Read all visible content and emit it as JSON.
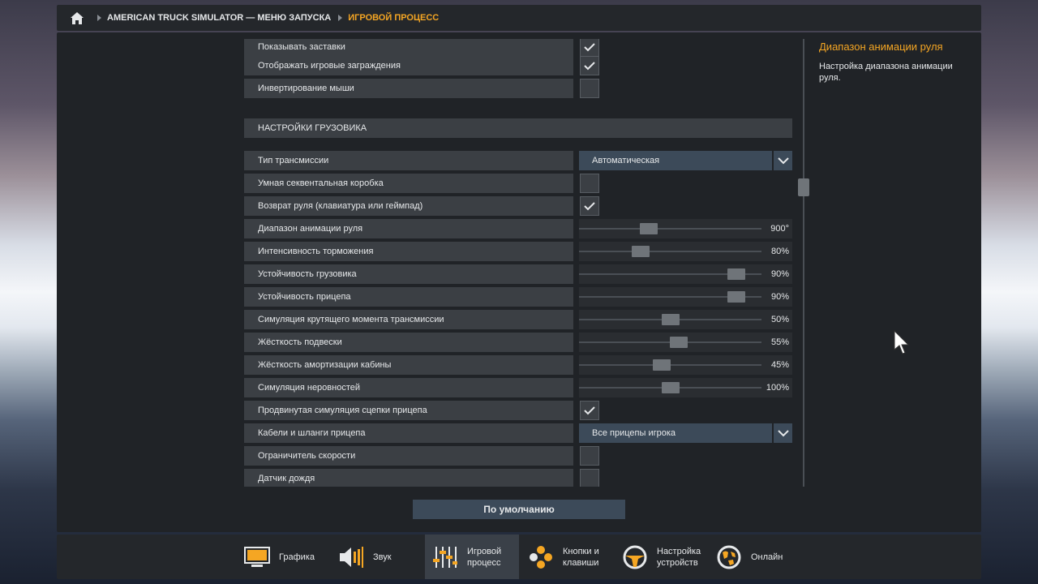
{
  "breadcrumb": {
    "items": [
      "AMERICAN TRUCK SIMULATOR — МЕНЮ ЗАПУСКА",
      "ИГРОВОЙ ПРОЦЕСС"
    ]
  },
  "settings": {
    "top_rows": [
      {
        "label": "Показывать заставки",
        "checked": true
      },
      {
        "label": "Отображать игровые заграждения",
        "checked": true
      },
      {
        "label": "Инвертирование мыши",
        "checked": false
      }
    ],
    "section_title": "НАСТРОЙКИ ГРУЗОВИКА",
    "transmission": {
      "label": "Тип трансмиссии",
      "value": "Автоматическая"
    },
    "smart_gearbox": {
      "label": "Умная секвентальная коробка",
      "checked": false
    },
    "steering_return": {
      "label": "Возврат руля (клавиатура или геймпад)",
      "checked": true
    },
    "sliders": [
      {
        "label": "Диапазон анимации руля",
        "value_text": "900°",
        "fraction": 0.37
      },
      {
        "label": "Интенсивность торможения",
        "value_text": "80%",
        "fraction": 0.32
      },
      {
        "label": "Устойчивость грузовика",
        "value_text": "90%",
        "fraction": 0.9
      },
      {
        "label": "Устойчивость прицепа",
        "value_text": "90%",
        "fraction": 0.9
      },
      {
        "label": "Симуляция крутящего момента трансмиссии",
        "value_text": "50%",
        "fraction": 0.5
      },
      {
        "label": "Жёсткость подвески",
        "value_text": "55%",
        "fraction": 0.55
      },
      {
        "label": "Жёсткость амортизации кабины",
        "value_text": "45%",
        "fraction": 0.45
      },
      {
        "label": "Симуляция неровностей",
        "value_text": "100%",
        "fraction": 0.5
      }
    ],
    "advanced_coupling": {
      "label": "Продвинутая симуляция сцепки прицепа",
      "checked": true
    },
    "cables": {
      "label": "Кабели и шланги прицепа",
      "value": "Все прицепы игрока"
    },
    "speed_limiter": {
      "label": "Ограничитель скорости",
      "checked": false
    },
    "rain_sensor": {
      "label": "Датчик дождя",
      "checked": false
    }
  },
  "help": {
    "title": "Диапазон анимации руля",
    "text": "Настройка диапазона анимации руля."
  },
  "default_button": "По умолчанию",
  "tabs": [
    {
      "label": "Графика",
      "icon": "monitor-icon"
    },
    {
      "label": "Звук",
      "icon": "speaker-icon"
    },
    {
      "label": "Игровой\nпроцесс",
      "icon": "sliders-icon",
      "active": true
    },
    {
      "label": "Кнопки и\nклавиши",
      "icon": "gamepad-icon"
    },
    {
      "label": "Настройка\nустройств",
      "icon": "steering-wheel-icon"
    },
    {
      "label": "Онлайн",
      "icon": "globe-icon"
    }
  ],
  "colors": {
    "accent": "#f5a623",
    "panel": "#202327",
    "row": "#3b3f44",
    "select": "#3c4a59"
  }
}
